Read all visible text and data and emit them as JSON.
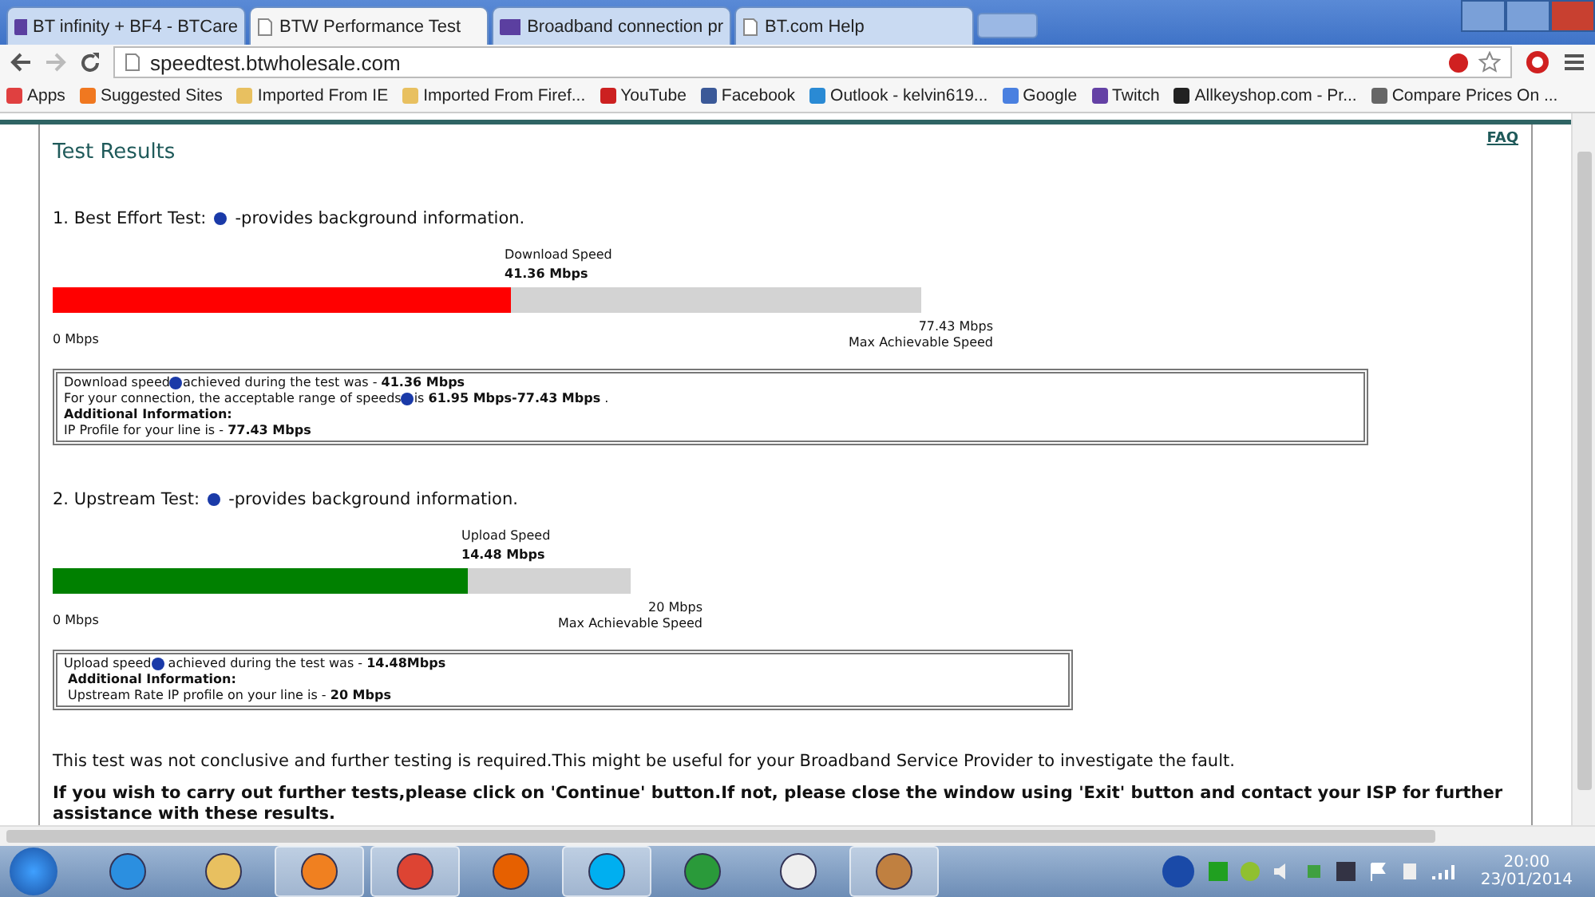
{
  "tabs": [
    {
      "label": "BT infinity + BF4 - BTCare",
      "kind": "bt",
      "selected": false
    },
    {
      "label": "BTW Performance Test",
      "kind": "page",
      "selected": true
    },
    {
      "label": "Broadband connection pr",
      "kind": "bt",
      "selected": false
    },
    {
      "label": "BT.com Help",
      "kind": "page",
      "selected": false
    }
  ],
  "address": {
    "url": "speedtest.btwholesale.com"
  },
  "bookmarks": [
    {
      "label": "Apps",
      "color": "#e04040"
    },
    {
      "label": "Suggested Sites",
      "color": "#f07820"
    },
    {
      "label": "Imported From IE",
      "color": "#e8c060"
    },
    {
      "label": "Imported From Firef...",
      "color": "#e8c060"
    },
    {
      "label": "YouTube",
      "color": "#cc2020"
    },
    {
      "label": "Facebook",
      "color": "#3b5998"
    },
    {
      "label": "Outlook - kelvin619...",
      "color": "#2a8ad4"
    },
    {
      "label": "Google",
      "color": "#4a80e0"
    },
    {
      "label": "Twitch",
      "color": "#6441a5"
    },
    {
      "label": "Allkeyshop.com - Pr...",
      "color": "#222222"
    },
    {
      "label": "Compare Prices On ...",
      "color": "#666666"
    }
  ],
  "page": {
    "title": "Test Results",
    "faq": "FAQ",
    "tests": [
      {
        "heading_lead": "1. Best Effort Test:",
        "heading_rest": "-provides background information.",
        "meter_label": "Download Speed",
        "meter_value": "41.36 Mbps",
        "level": 0.528,
        "color": "#ff0000",
        "min": "0 Mbps",
        "max": "77.43 Mbps",
        "max_caption": "Max Achievable Speed",
        "info": [
          {
            "lead": "Download speed",
            "help": true,
            "rest": "achieved during the test was - **41.36 Mbps**"
          },
          {
            "lead": "For your connection, the acceptable range of speeds",
            "help": true,
            "rest": "is **61.95 Mbps-77.43 Mbps** ."
          },
          {
            "lead": "**Additional Information:**",
            "help": false
          },
          {
            "lead": "IP Profile for your line is - **77.43 Mbps**",
            "help": false
          }
        ]
      },
      {
        "heading_lead": "2. Upstream Test:",
        "heading_rest": "-provides background information.",
        "meter_label": "Upload Speed",
        "meter_value": "14.48 Mbps",
        "level": 0.718,
        "color": "#008000",
        "min": "0 Mbps",
        "max": "20 Mbps",
        "max_caption": "Max Achievable Speed",
        "info": [
          {
            "lead": "Upload speed",
            "help": true,
            "rest": " achieved during the test was - **14.48Mbps**"
          },
          {
            "lead": " **Additional Information:**",
            "help": false
          },
          {
            "lead": " Upstream Rate IP profile on your line is - **20 Mbps**",
            "help": false
          }
        ]
      }
    ],
    "note": "This test was not conclusive and further testing is required.This might be useful for your Broadband Service Provider to investigate the fault.",
    "instruction": "If you wish to carry out further tests,please click on 'Continue' button.If not, please close the window using 'Exit' button and contact your ISP for further assistance with these results."
  },
  "taskbar": {
    "apps": [
      {
        "kind": "ie",
        "selected": false
      },
      {
        "kind": "folder",
        "selected": false
      },
      {
        "kind": "media",
        "selected": true
      },
      {
        "kind": "chrome",
        "selected": true
      },
      {
        "kind": "firefox",
        "selected": false
      },
      {
        "kind": "skype",
        "selected": true
      },
      {
        "kind": "torrent",
        "selected": false
      },
      {
        "kind": "mouse",
        "selected": false
      },
      {
        "kind": "paint",
        "selected": true
      }
    ],
    "time": "20:00",
    "date": "23/01/2014"
  }
}
